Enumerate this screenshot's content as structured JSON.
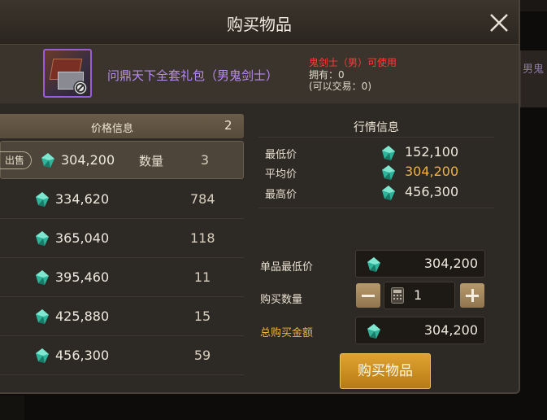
{
  "background": {
    "side_tab_text": "男鬼"
  },
  "dialog": {
    "title": "购买物品",
    "close_icon": "close-icon"
  },
  "item": {
    "name": "问鼎天下全套礼包（男鬼剑士）",
    "restriction": "鬼剑士（男）可使用",
    "owned": "拥有：0",
    "tradable": "(可以交易：0)",
    "name_color": "#b88bf0",
    "restriction_color": "#ff3b3b"
  },
  "price_list": {
    "header": "价格信息",
    "page": "2",
    "selected": {
      "tag": "出售",
      "price": "304,200",
      "qty_label": "数量",
      "qty": "3"
    },
    "rows": [
      {
        "price": "334,620",
        "qty": "784"
      },
      {
        "price": "365,040",
        "qty": "118"
      },
      {
        "price": "395,460",
        "qty": "11"
      },
      {
        "price": "425,880",
        "qty": "15"
      },
      {
        "price": "456,300",
        "qty": "59"
      }
    ]
  },
  "market": {
    "header": "行情信息",
    "min": {
      "label": "最低价",
      "value": "152,100"
    },
    "avg": {
      "label": "平均价",
      "value": "304,200"
    },
    "max": {
      "label": "最高价",
      "value": "456,300"
    },
    "highlight_color": "#f2b33d"
  },
  "purchase": {
    "unit_label": "单品最低价",
    "unit_value": "304,200",
    "qty_label": "购买数量",
    "qty_value": "1",
    "total_label": "总购买金额",
    "total_value": "304,200",
    "buy_button": "购买物品",
    "accent_color": "#e0a232"
  }
}
